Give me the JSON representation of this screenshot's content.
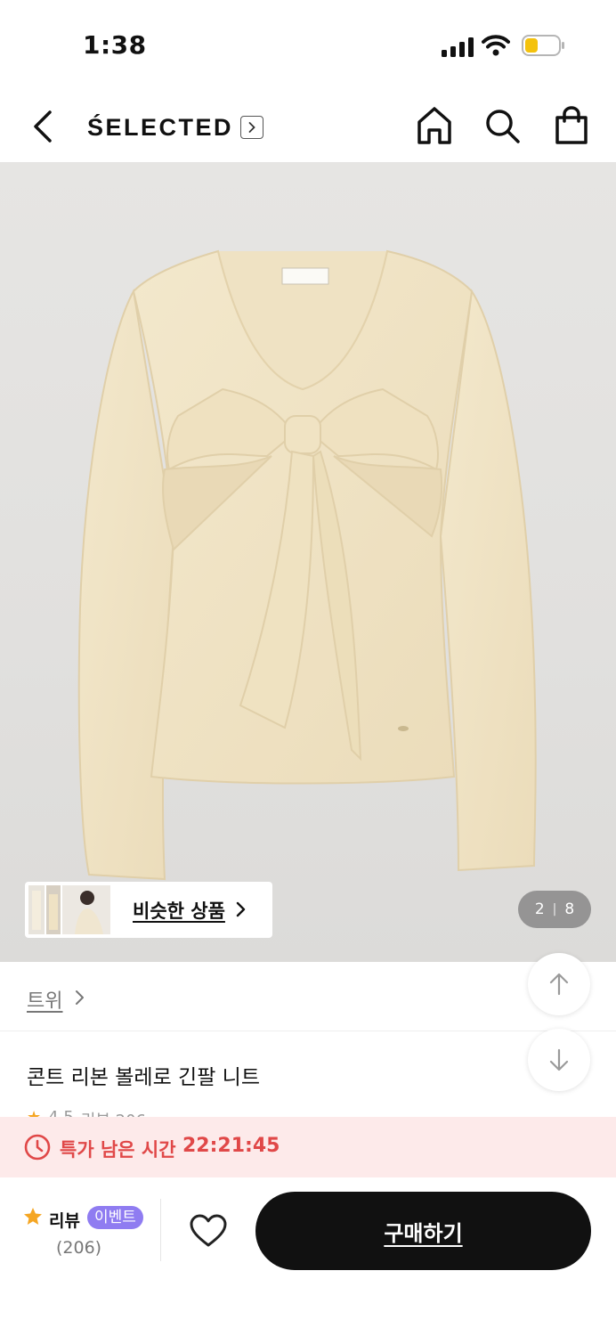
{
  "status_bar": {
    "time": "1:38",
    "icons": [
      "cellular-signal-icon",
      "wifi-icon",
      "battery-icon"
    ],
    "battery_color": "#f4c20d"
  },
  "header": {
    "brand": "ŚELECTED",
    "icons": [
      "back-chevron-icon",
      "chevron-right-icon",
      "home-icon",
      "search-icon",
      "shopping-bag-icon"
    ]
  },
  "gallery": {
    "similar_products_label": "비슷한 상품",
    "current_page": "2",
    "total_pages": "8",
    "background_color": "#e3e2e0",
    "product_color": "#f0e4c7"
  },
  "product": {
    "brand_link": "트위",
    "title": "콘트 리본 볼레로 긴팔 니트",
    "rating_peek": "4.5",
    "reviews_peek": "리뷰 206"
  },
  "deal": {
    "label": "특가 남은 시간",
    "remaining_time": "22:21:45",
    "accent_color": "#e04848",
    "background_color": "#fdeaea"
  },
  "bottom_bar": {
    "review_label": "리뷰",
    "event_badge": "이벤트",
    "review_count": "(206)",
    "buy_button": "구매하기",
    "badge_color": "#8f7cf1",
    "star_color": "#f5a623"
  }
}
